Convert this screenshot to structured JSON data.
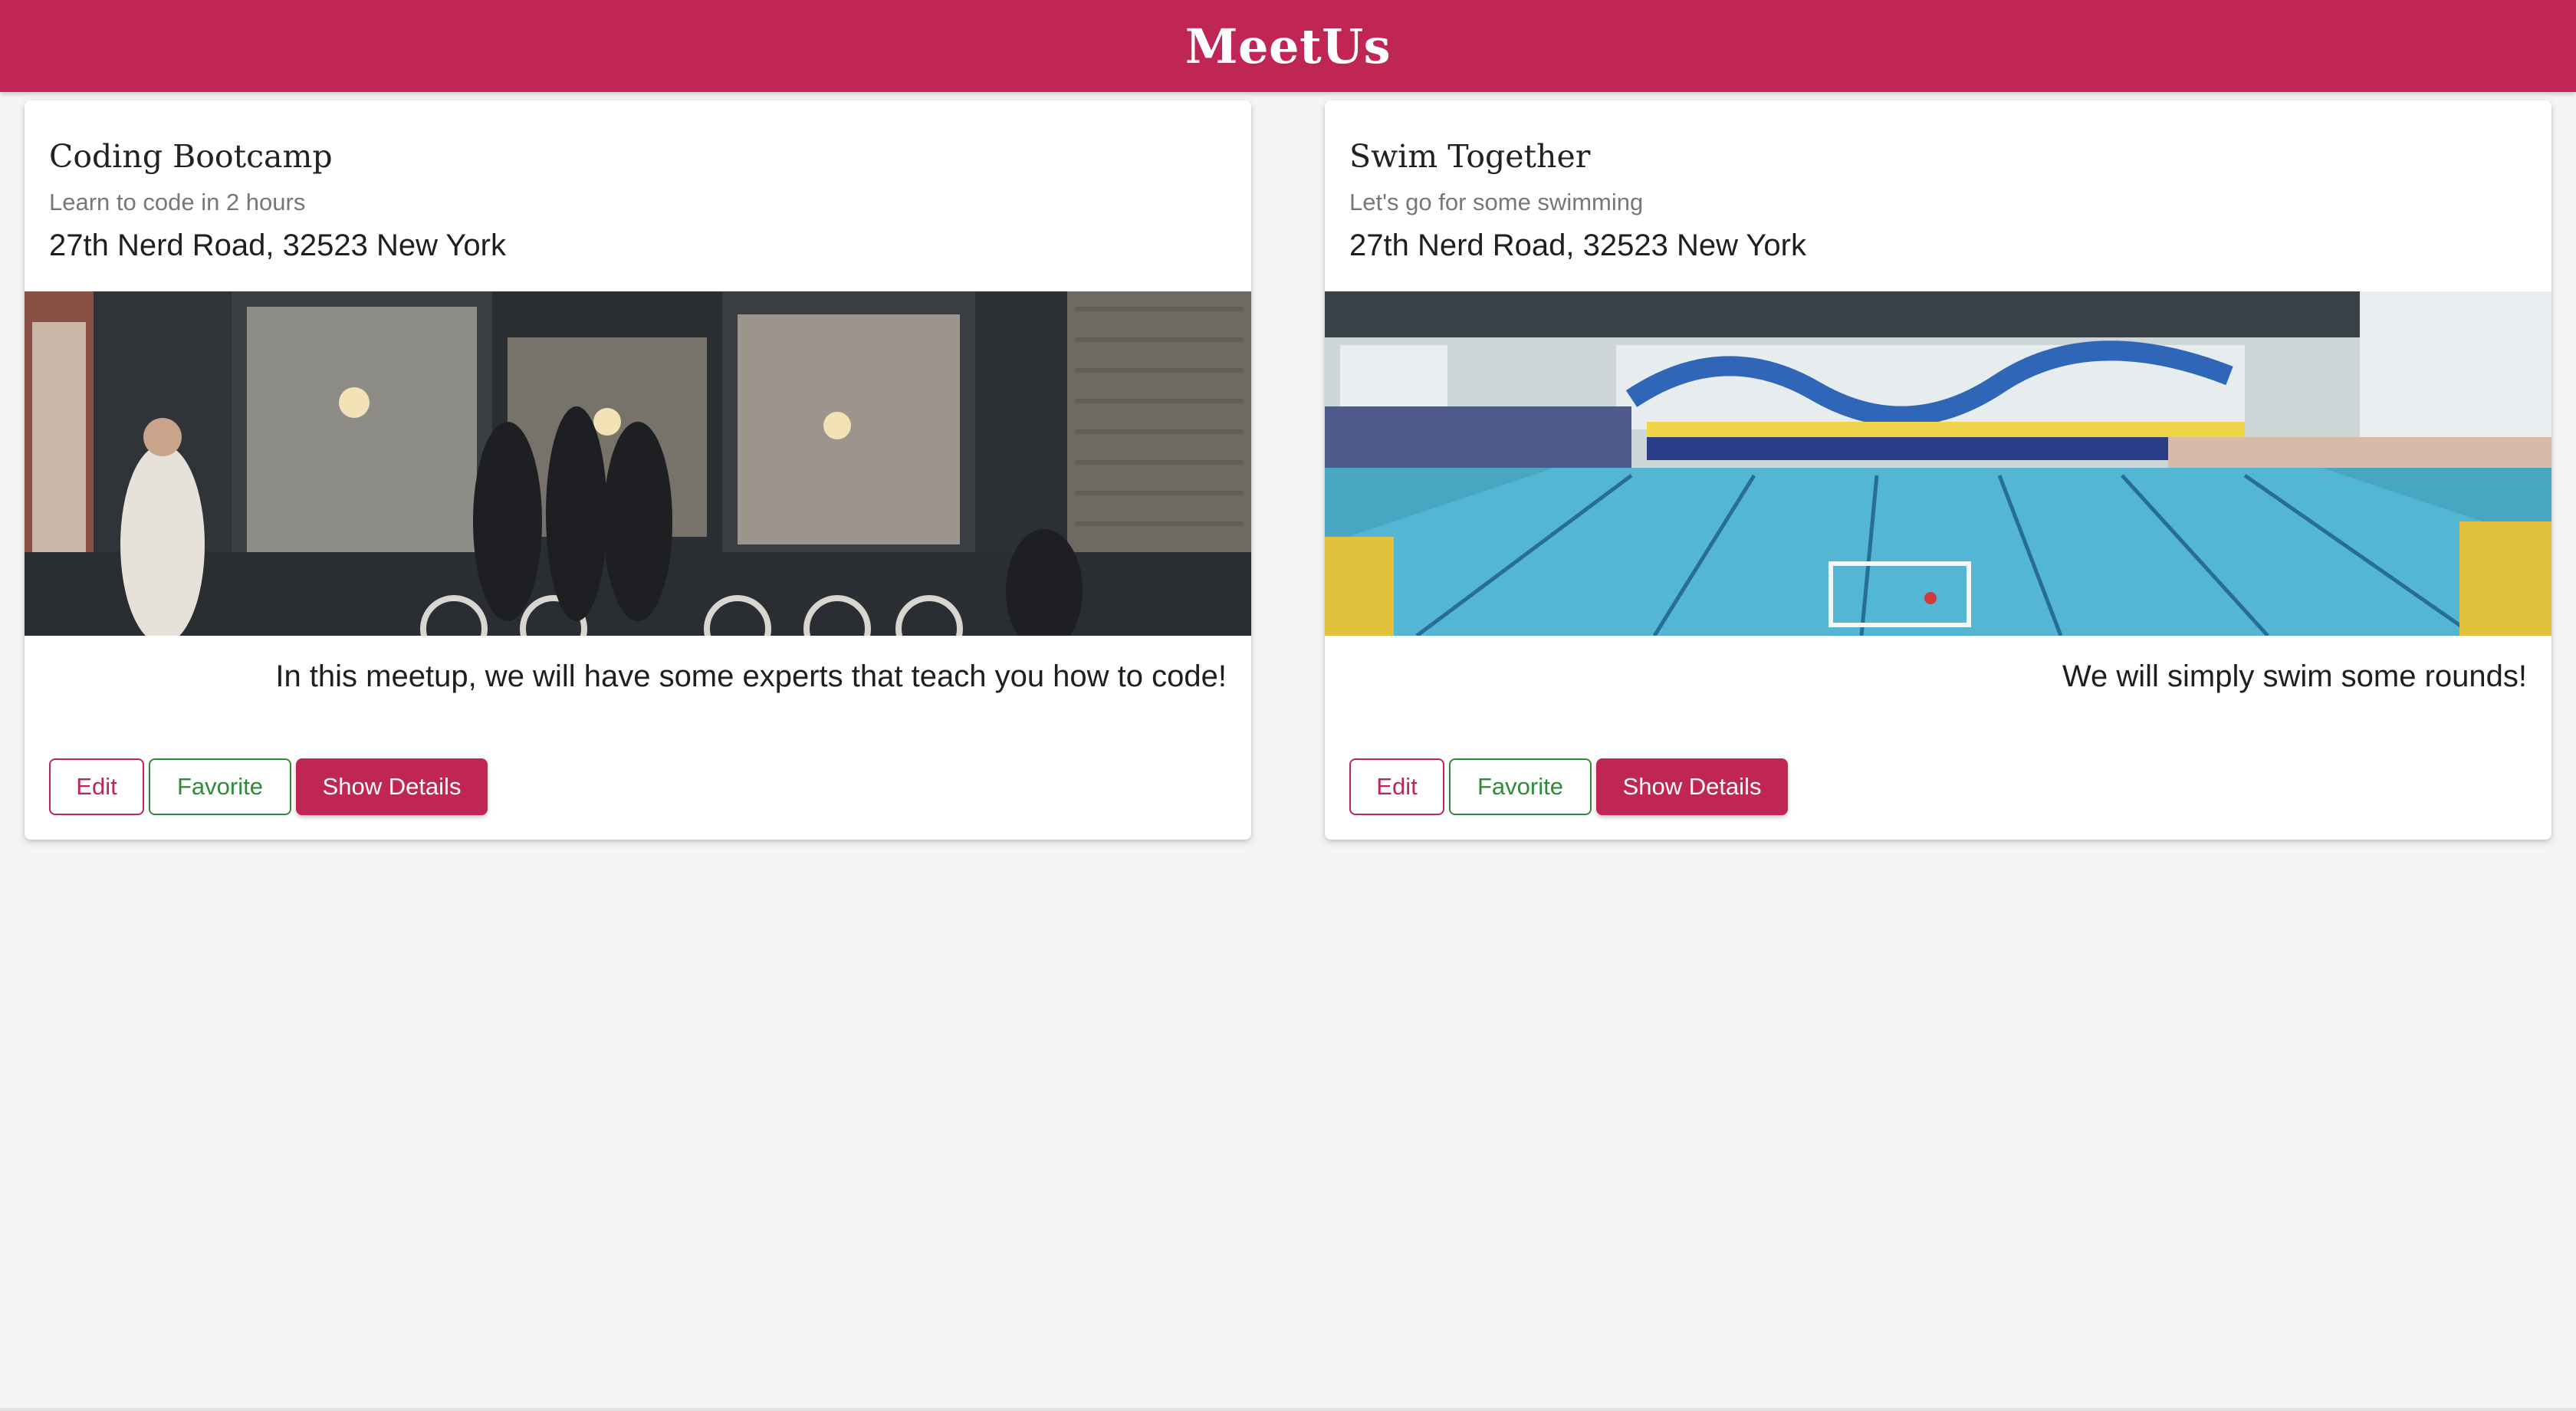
{
  "app": {
    "title": "MeetUs",
    "accent_color": "#c02655",
    "favorite_color": "#2e8b3a"
  },
  "meetups": [
    {
      "title": "Coding Bootcamp",
      "subtitle": "Learn to code in 2 hours",
      "address": "27th Nerd Road, 32523 New York",
      "image_description": "coffee-shop-street-photo",
      "description": "In this meetup, we will have some experts that teach you how to code!",
      "actions": {
        "edit_label": "Edit",
        "favorite_label": "Favorite",
        "details_label": "Show Details"
      }
    },
    {
      "title": "Swim Together",
      "subtitle": "Let's go for some swimming",
      "address": "27th Nerd Road, 32523 New York",
      "image_description": "indoor-swimming-pool-photo",
      "description": "We will simply swim some rounds!",
      "actions": {
        "edit_label": "Edit",
        "favorite_label": "Favorite",
        "details_label": "Show Details"
      }
    }
  ]
}
